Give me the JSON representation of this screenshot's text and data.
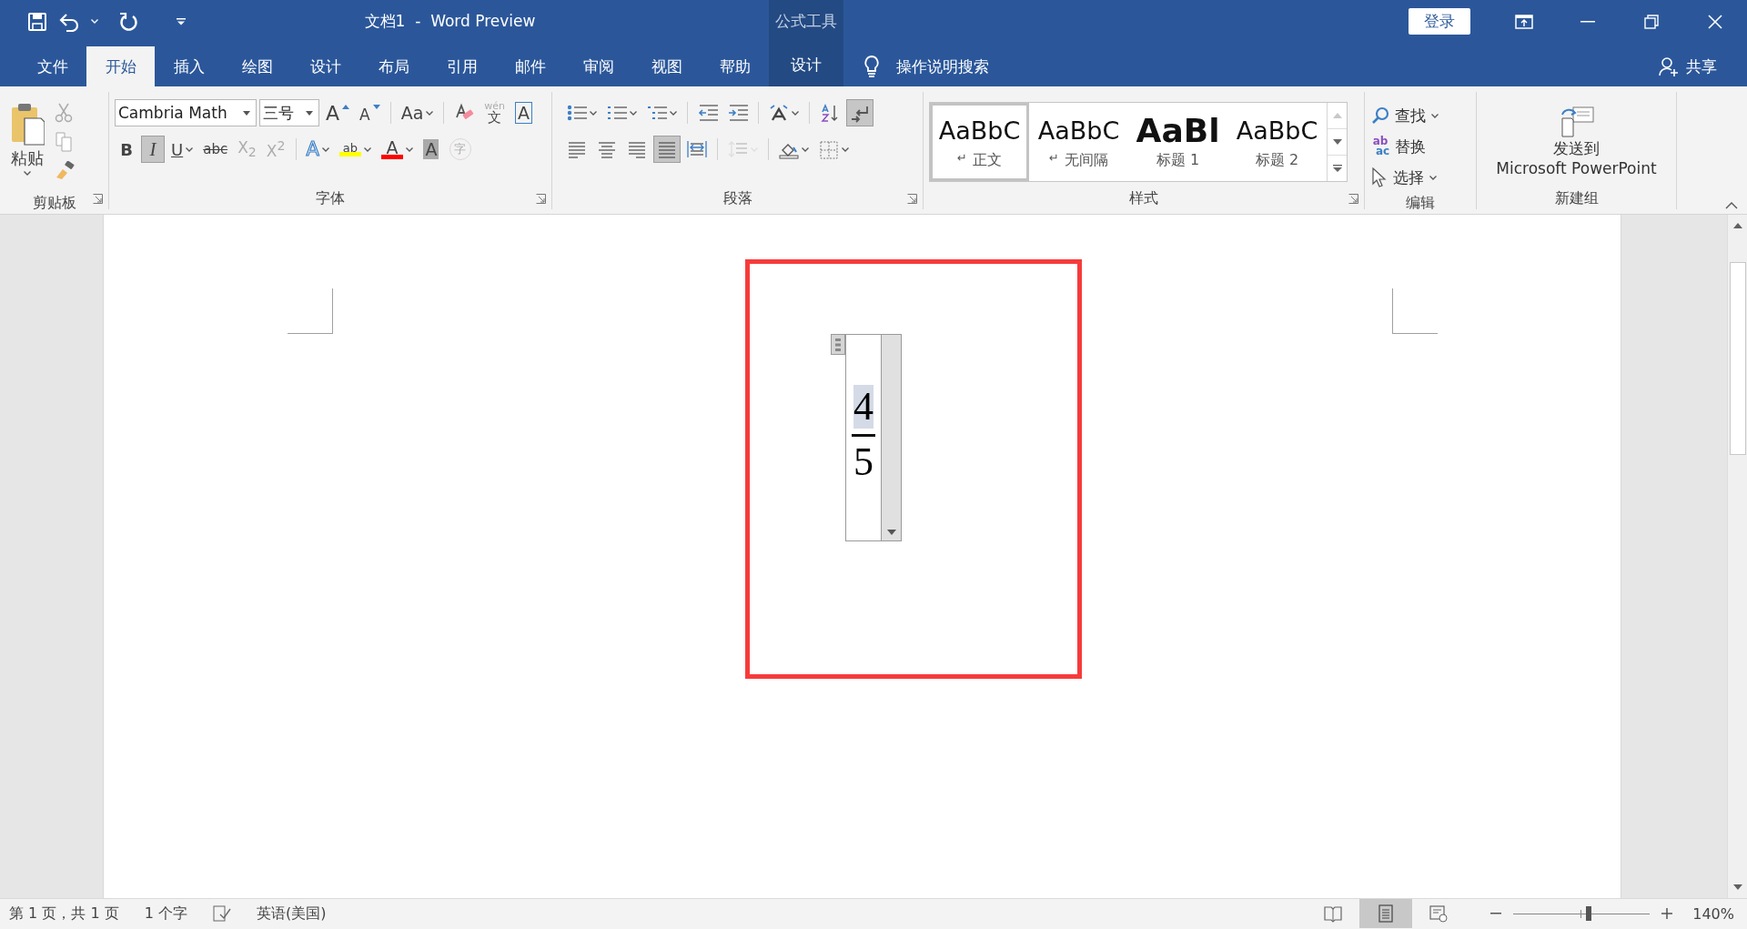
{
  "window": {
    "title": "文档1  -  Word Preview",
    "context_label": "公式工具",
    "sign_in": "登录"
  },
  "tabs": [
    {
      "label": "文件",
      "selected": false,
      "kind": "normal"
    },
    {
      "label": "开始",
      "selected": true,
      "kind": "normal"
    },
    {
      "label": "插入",
      "selected": false,
      "kind": "normal"
    },
    {
      "label": "绘图",
      "selected": false,
      "kind": "normal"
    },
    {
      "label": "设计",
      "selected": false,
      "kind": "normal"
    },
    {
      "label": "布局",
      "selected": false,
      "kind": "normal"
    },
    {
      "label": "引用",
      "selected": false,
      "kind": "normal"
    },
    {
      "label": "邮件",
      "selected": false,
      "kind": "normal"
    },
    {
      "label": "审阅",
      "selected": false,
      "kind": "normal"
    },
    {
      "label": "视图",
      "selected": false,
      "kind": "normal"
    },
    {
      "label": "帮助",
      "selected": false,
      "kind": "normal"
    },
    {
      "label": "设计",
      "selected": false,
      "kind": "contextual"
    }
  ],
  "tell_me": "操作说明搜索",
  "share": "共享",
  "ribbon": {
    "clipboard": {
      "paste": "粘贴",
      "label": "剪贴板"
    },
    "font": {
      "font_name": "Cambria Math",
      "font_size": "三号",
      "label": "字体",
      "row1": [
        {
          "kind": "grow_font",
          "label": "A",
          "disabled": false
        },
        {
          "kind": "shrink_font",
          "label": "A",
          "disabled": false
        },
        {
          "kind": "change_case",
          "label": "Aa",
          "disabled": false
        },
        {
          "kind": "clear_format",
          "disabled": false
        },
        {
          "kind": "phonetic",
          "label": "文",
          "ruby": "wén",
          "disabled": true
        },
        {
          "kind": "char_border",
          "label": "A",
          "disabled": false
        }
      ],
      "row2": [
        {
          "kind": "bold",
          "label": "B",
          "pressed": false,
          "disabled": false
        },
        {
          "kind": "italic",
          "label": "I",
          "pressed": true,
          "disabled": false
        },
        {
          "kind": "underline",
          "label": "U",
          "pressed": false,
          "disabled": false
        },
        {
          "kind": "strike",
          "label": "abc",
          "pressed": false,
          "disabled": false
        },
        {
          "kind": "subscript",
          "label": "X$_{2}$",
          "pressed": false,
          "disabled": true
        },
        {
          "kind": "superscript",
          "label": "X$^{2}$",
          "pressed": false,
          "disabled": true
        },
        {
          "kind": "text_effect",
          "label": "A",
          "pressed": false,
          "disabled": false
        },
        {
          "kind": "highlight",
          "label": "ab",
          "color": "#ffff00",
          "pressed": false,
          "disabled": false
        },
        {
          "kind": "font_color",
          "label": "A",
          "color": "#ff0000",
          "pressed": false,
          "disabled": false
        },
        {
          "kind": "char_shading",
          "label": "A",
          "pressed": false,
          "disabled": false
        },
        {
          "kind": "enclose",
          "label": "字",
          "pressed": false,
          "disabled": true
        }
      ]
    },
    "paragraph": {
      "label": "段落",
      "row1": [
        {
          "kind": "bullets",
          "pressed": false,
          "disabled": false
        },
        {
          "kind": "numbering",
          "pressed": false,
          "disabled": false
        },
        {
          "kind": "multilevel",
          "pressed": false,
          "disabled": false
        },
        {
          "kind": "outdent",
          "pressed": false,
          "disabled": false
        },
        {
          "kind": "indent",
          "pressed": false,
          "disabled": false
        },
        {
          "kind": "asian_layout",
          "pressed": false,
          "disabled": false
        },
        {
          "kind": "sort",
          "pressed": false,
          "disabled": false
        },
        {
          "kind": "show_marks",
          "pressed": true,
          "disabled": false
        }
      ],
      "row2": [
        {
          "kind": "align_left",
          "pressed": false,
          "disabled": false
        },
        {
          "kind": "align_center",
          "pressed": false,
          "disabled": false
        },
        {
          "kind": "align_right",
          "pressed": false,
          "disabled": false
        },
        {
          "kind": "justify",
          "pressed": true,
          "disabled": false
        },
        {
          "kind": "distribute",
          "pressed": false,
          "disabled": false
        },
        {
          "kind": "line_spacing",
          "pressed": false,
          "disabled": true
        },
        {
          "kind": "shading",
          "pressed": false,
          "disabled": false
        },
        {
          "kind": "borders",
          "pressed": false,
          "disabled": false
        }
      ]
    },
    "styles": {
      "label": "样式",
      "items": [
        {
          "preview": "AaBbC",
          "name": "正文",
          "para_mark": "↵",
          "selected": true,
          "kind": "body"
        },
        {
          "preview": "AaBbC",
          "name": "无间隔",
          "para_mark": "↵",
          "selected": false,
          "kind": "body"
        },
        {
          "preview": "AaBl",
          "name": "标题 1",
          "selected": false,
          "kind": "heading1"
        },
        {
          "preview": "AaBbC",
          "name": "标题 2",
          "selected": false,
          "kind": "heading2"
        }
      ]
    },
    "editing": {
      "label": "编辑",
      "items": [
        {
          "kind": "find",
          "label": "查找"
        },
        {
          "kind": "replace",
          "label": "替换",
          "glyph_top": "ab",
          "glyph_bottom": "ac"
        },
        {
          "kind": "select",
          "label": "选择"
        }
      ]
    },
    "new_group": {
      "button_lines": [
        "发送到",
        "Microsoft PowerPoint"
      ],
      "label": "新建组"
    }
  },
  "document": {
    "equation": {
      "numerator": "4",
      "denominator": "5",
      "numerator_selected": true
    }
  },
  "status_bar": {
    "page_info": "第 1 页，共 1 页",
    "word_count": "1 个字",
    "language": "英语(美国)",
    "views": [
      {
        "kind": "read",
        "selected": false
      },
      {
        "kind": "print",
        "selected": true
      },
      {
        "kind": "web",
        "selected": false
      }
    ],
    "zoom": {
      "level": 0.55,
      "percent": "140%"
    }
  }
}
